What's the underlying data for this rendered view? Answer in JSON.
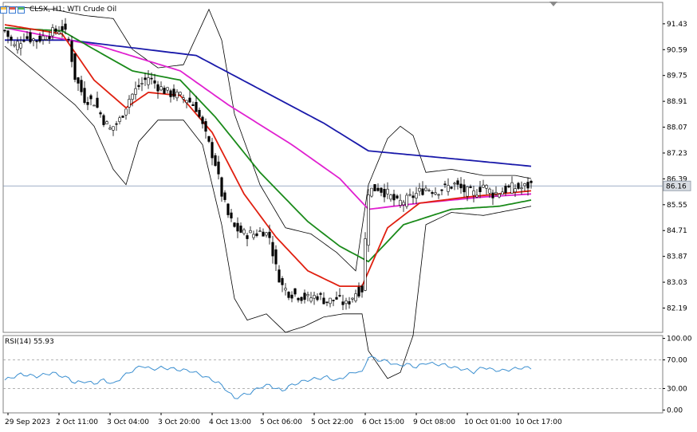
{
  "header": {
    "icons": [
      "chart-window-icon",
      "chart-window-icon",
      "chart-window-icon"
    ],
    "title": "CLSX, H1:  WTI Crude Oil"
  },
  "chart_data": [
    {
      "type": "candlestick",
      "title": "CLSX, H1:  WTI Crude Oil",
      "current_price": "86.16",
      "y_ticks": [
        "91.43",
        "90.59",
        "89.75",
        "88.91",
        "88.07",
        "87.23",
        "86.39",
        "85.55",
        "84.71",
        "83.87",
        "83.03",
        "82.19"
      ],
      "ylim": [
        81.4,
        92.1
      ],
      "x_ticks": [
        "29 Sep 2023",
        "2 Oct 11:00",
        "3 Oct 04:00",
        "3 Oct 20:00",
        "4 Oct 13:00",
        "5 Oct 06:00",
        "5 Oct 22:00",
        "6 Oct 15:00",
        "9 Oct 08:00",
        "10 Oct 01:00",
        "10 Oct 17:00"
      ],
      "x_tick_index": [
        1,
        17,
        33,
        49,
        65,
        81,
        97,
        113,
        129,
        145,
        161
      ],
      "close_anchors": [
        [
          0,
          91.2
        ],
        [
          3,
          90.7
        ],
        [
          6,
          91.0
        ],
        [
          10,
          90.9
        ],
        [
          14,
          91.1
        ],
        [
          18,
          91.3
        ],
        [
          20,
          90.9
        ],
        [
          22,
          89.7
        ],
        [
          25,
          89.0
        ],
        [
          28,
          88.9
        ],
        [
          31,
          88.3
        ],
        [
          33,
          88.0
        ],
        [
          36,
          88.3
        ],
        [
          39,
          89.0
        ],
        [
          42,
          89.4
        ],
        [
          45,
          89.7
        ],
        [
          48,
          89.4
        ],
        [
          51,
          89.2
        ],
        [
          54,
          89.1
        ],
        [
          57,
          89.0
        ],
        [
          60,
          88.7
        ],
        [
          63,
          87.8
        ],
        [
          66,
          86.9
        ],
        [
          68,
          85.9
        ],
        [
          70,
          85.2
        ],
        [
          72,
          84.8
        ],
        [
          75,
          84.6
        ],
        [
          78,
          84.6
        ],
        [
          81,
          84.7
        ],
        [
          83,
          84.5
        ],
        [
          85,
          83.5
        ],
        [
          87,
          82.9
        ],
        [
          89,
          82.7
        ],
        [
          92,
          82.6
        ],
        [
          95,
          82.5
        ],
        [
          98,
          82.6
        ],
        [
          101,
          82.4
        ],
        [
          104,
          82.5
        ],
        [
          107,
          82.3
        ],
        [
          110,
          82.7
        ],
        [
          112,
          82.8
        ],
        [
          114,
          86.0
        ],
        [
          117,
          86.1
        ],
        [
          120,
          85.9
        ],
        [
          123,
          85.6
        ],
        [
          126,
          85.7
        ],
        [
          129,
          85.9
        ],
        [
          132,
          86.1
        ],
        [
          135,
          86.0
        ],
        [
          138,
          86.1
        ],
        [
          141,
          86.2
        ],
        [
          144,
          86.0
        ],
        [
          147,
          85.9
        ],
        [
          150,
          86.2
        ],
        [
          153,
          85.9
        ],
        [
          156,
          86.0
        ],
        [
          159,
          86.1
        ],
        [
          162,
          86.1
        ],
        [
          165,
          86.2
        ]
      ],
      "series": [
        {
          "type": "line",
          "color": "#1a1aaa",
          "values": [
            [
              0,
              90.9
            ],
            [
              20,
              90.9
            ],
            [
              60,
              90.4
            ],
            [
              80,
              89.3
            ],
            [
              100,
              88.2
            ],
            [
              114,
              87.3
            ],
            [
              145,
              87.0
            ],
            [
              165,
              86.8
            ]
          ]
        },
        {
          "type": "line",
          "color": "#e020d0",
          "values": [
            [
              0,
              91.3
            ],
            [
              30,
              90.7
            ],
            [
              55,
              89.9
            ],
            [
              70,
              88.8
            ],
            [
              90,
              87.5
            ],
            [
              105,
              86.4
            ],
            [
              114,
              85.4
            ],
            [
              130,
              85.6
            ],
            [
              150,
              85.8
            ],
            [
              165,
              85.9
            ]
          ]
        },
        {
          "type": "line",
          "color": "#1a8a1a",
          "values": [
            [
              0,
              91.3
            ],
            [
              18,
              91.2
            ],
            [
              28,
              90.6
            ],
            [
              40,
              89.9
            ],
            [
              55,
              89.6
            ],
            [
              66,
              88.4
            ],
            [
              80,
              86.6
            ],
            [
              95,
              85.0
            ],
            [
              105,
              84.2
            ],
            [
              114,
              83.7
            ],
            [
              125,
              84.9
            ],
            [
              140,
              85.4
            ],
            [
              155,
              85.5
            ],
            [
              165,
              85.7
            ]
          ]
        },
        {
          "type": "line",
          "color": "#e02010",
          "values": [
            [
              0,
              91.4
            ],
            [
              18,
              91.1
            ],
            [
              28,
              89.6
            ],
            [
              38,
              88.7
            ],
            [
              45,
              89.2
            ],
            [
              55,
              89.1
            ],
            [
              65,
              87.9
            ],
            [
              75,
              85.9
            ],
            [
              85,
              84.5
            ],
            [
              95,
              83.4
            ],
            [
              105,
              82.9
            ],
            [
              112,
              82.9
            ],
            [
              120,
              84.8
            ],
            [
              130,
              85.6
            ],
            [
              145,
              85.8
            ],
            [
              165,
              86.0
            ]
          ]
        },
        {
          "type": "bollinger",
          "color": "#000000",
          "upper": [
            [
              0,
              92.0
            ],
            [
              15,
              91.9
            ],
            [
              25,
              91.7
            ],
            [
              34,
              91.6
            ],
            [
              40,
              90.6
            ],
            [
              48,
              90.0
            ],
            [
              56,
              90.1
            ],
            [
              60,
              91.0
            ],
            [
              64,
              91.9
            ],
            [
              68,
              90.9
            ],
            [
              72,
              88.5
            ],
            [
              80,
              86.2
            ],
            [
              88,
              84.8
            ],
            [
              96,
              84.6
            ],
            [
              104,
              84.0
            ],
            [
              110,
              83.4
            ],
            [
              114,
              86.2
            ],
            [
              120,
              87.7
            ],
            [
              124,
              88.1
            ],
            [
              128,
              87.8
            ],
            [
              132,
              86.6
            ],
            [
              140,
              86.7
            ],
            [
              150,
              86.5
            ],
            [
              160,
              86.5
            ],
            [
              165,
              86.4
            ]
          ],
          "lower": [
            [
              0,
              90.7
            ],
            [
              15,
              89.4
            ],
            [
              22,
              88.8
            ],
            [
              28,
              88.1
            ],
            [
              34,
              86.7
            ],
            [
              38,
              86.2
            ],
            [
              42,
              87.6
            ],
            [
              48,
              88.3
            ],
            [
              56,
              88.3
            ],
            [
              62,
              87.5
            ],
            [
              68,
              84.9
            ],
            [
              72,
              82.5
            ],
            [
              76,
              81.8
            ],
            [
              82,
              82.0
            ],
            [
              88,
              81.4
            ],
            [
              94,
              81.6
            ],
            [
              100,
              81.9
            ],
            [
              106,
              82.0
            ],
            [
              112,
              82.0
            ],
            [
              114,
              80.8
            ],
            [
              120,
              79.9
            ],
            [
              124,
              80.1
            ],
            [
              128,
              81.3
            ],
            [
              132,
              84.9
            ],
            [
              140,
              85.3
            ],
            [
              150,
              85.2
            ],
            [
              160,
              85.4
            ],
            [
              165,
              85.5
            ]
          ]
        }
      ]
    },
    {
      "type": "line",
      "title": "RSI(14) 55.93",
      "ylim": [
        -4,
        104
      ],
      "y_ticks": [
        "100.00",
        "70.00",
        "30.00",
        "0.00"
      ],
      "levels": [
        70,
        30
      ],
      "color": "#3b8fd0",
      "values": [
        [
          0,
          42
        ],
        [
          5,
          50
        ],
        [
          10,
          47
        ],
        [
          15,
          52
        ],
        [
          20,
          44
        ],
        [
          22,
          38
        ],
        [
          25,
          40
        ],
        [
          28,
          37
        ],
        [
          31,
          42
        ],
        [
          34,
          36
        ],
        [
          37,
          47
        ],
        [
          40,
          55
        ],
        [
          43,
          62
        ],
        [
          46,
          57
        ],
        [
          49,
          59
        ],
        [
          52,
          58
        ],
        [
          55,
          56
        ],
        [
          58,
          55
        ],
        [
          61,
          50
        ],
        [
          64,
          44
        ],
        [
          67,
          38
        ],
        [
          70,
          26
        ],
        [
          72,
          16
        ],
        [
          74,
          20
        ],
        [
          77,
          24
        ],
        [
          80,
          32
        ],
        [
          83,
          35
        ],
        [
          85,
          30
        ],
        [
          87,
          27
        ],
        [
          89,
          33
        ],
        [
          92,
          38
        ],
        [
          95,
          42
        ],
        [
          98,
          44
        ],
        [
          101,
          46
        ],
        [
          104,
          41
        ],
        [
          107,
          48
        ],
        [
          110,
          54
        ],
        [
          112,
          52
        ],
        [
          114,
          75
        ],
        [
          117,
          70
        ],
        [
          120,
          68
        ],
        [
          123,
          62
        ],
        [
          126,
          64
        ],
        [
          129,
          60
        ],
        [
          132,
          66
        ],
        [
          135,
          64
        ],
        [
          138,
          63
        ],
        [
          141,
          59
        ],
        [
          144,
          57
        ],
        [
          147,
          53
        ],
        [
          150,
          60
        ],
        [
          153,
          56
        ],
        [
          156,
          55
        ],
        [
          159,
          57
        ],
        [
          162,
          59
        ],
        [
          165,
          59
        ]
      ]
    }
  ]
}
